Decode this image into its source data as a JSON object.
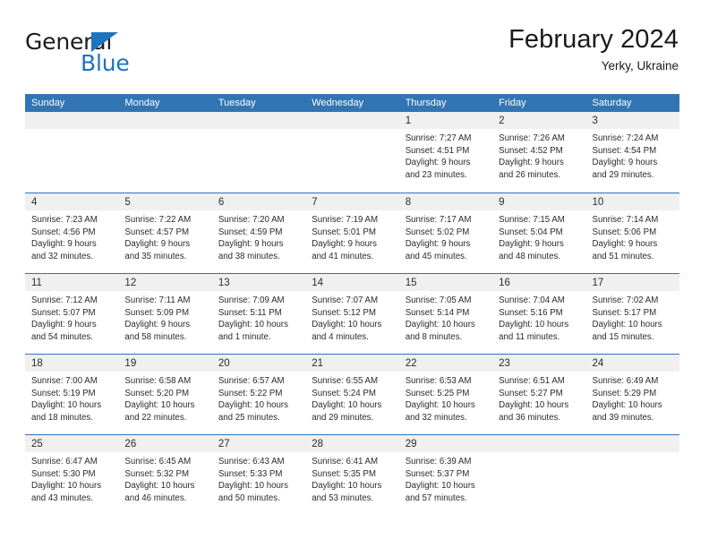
{
  "brand": {
    "name_part1": "General",
    "name_part2": "Blue",
    "accent_color": "#1e73be"
  },
  "header": {
    "title": "February 2024",
    "subtitle": "Yerky, Ukraine"
  },
  "theme": {
    "header_blue": "#3275b4",
    "rule_blue": "#2e74b5",
    "day_band_gray": "#f0f0f0"
  },
  "weekdays": [
    "Sunday",
    "Monday",
    "Tuesday",
    "Wednesday",
    "Thursday",
    "Friday",
    "Saturday"
  ],
  "weeks": [
    [
      {
        "day": "",
        "empty": true
      },
      {
        "day": "",
        "empty": true
      },
      {
        "day": "",
        "empty": true
      },
      {
        "day": "",
        "empty": true
      },
      {
        "day": "1",
        "sunrise": "Sunrise: 7:27 AM",
        "sunset": "Sunset: 4:51 PM",
        "daylight1": "Daylight: 9 hours",
        "daylight2": "and 23 minutes."
      },
      {
        "day": "2",
        "sunrise": "Sunrise: 7:26 AM",
        "sunset": "Sunset: 4:52 PM",
        "daylight1": "Daylight: 9 hours",
        "daylight2": "and 26 minutes."
      },
      {
        "day": "3",
        "sunrise": "Sunrise: 7:24 AM",
        "sunset": "Sunset: 4:54 PM",
        "daylight1": "Daylight: 9 hours",
        "daylight2": "and 29 minutes."
      }
    ],
    [
      {
        "day": "4",
        "sunrise": "Sunrise: 7:23 AM",
        "sunset": "Sunset: 4:56 PM",
        "daylight1": "Daylight: 9 hours",
        "daylight2": "and 32 minutes."
      },
      {
        "day": "5",
        "sunrise": "Sunrise: 7:22 AM",
        "sunset": "Sunset: 4:57 PM",
        "daylight1": "Daylight: 9 hours",
        "daylight2": "and 35 minutes."
      },
      {
        "day": "6",
        "sunrise": "Sunrise: 7:20 AM",
        "sunset": "Sunset: 4:59 PM",
        "daylight1": "Daylight: 9 hours",
        "daylight2": "and 38 minutes."
      },
      {
        "day": "7",
        "sunrise": "Sunrise: 7:19 AM",
        "sunset": "Sunset: 5:01 PM",
        "daylight1": "Daylight: 9 hours",
        "daylight2": "and 41 minutes."
      },
      {
        "day": "8",
        "sunrise": "Sunrise: 7:17 AM",
        "sunset": "Sunset: 5:02 PM",
        "daylight1": "Daylight: 9 hours",
        "daylight2": "and 45 minutes."
      },
      {
        "day": "9",
        "sunrise": "Sunrise: 7:15 AM",
        "sunset": "Sunset: 5:04 PM",
        "daylight1": "Daylight: 9 hours",
        "daylight2": "and 48 minutes."
      },
      {
        "day": "10",
        "sunrise": "Sunrise: 7:14 AM",
        "sunset": "Sunset: 5:06 PM",
        "daylight1": "Daylight: 9 hours",
        "daylight2": "and 51 minutes."
      }
    ],
    [
      {
        "day": "11",
        "sunrise": "Sunrise: 7:12 AM",
        "sunset": "Sunset: 5:07 PM",
        "daylight1": "Daylight: 9 hours",
        "daylight2": "and 54 minutes."
      },
      {
        "day": "12",
        "sunrise": "Sunrise: 7:11 AM",
        "sunset": "Sunset: 5:09 PM",
        "daylight1": "Daylight: 9 hours",
        "daylight2": "and 58 minutes."
      },
      {
        "day": "13",
        "sunrise": "Sunrise: 7:09 AM",
        "sunset": "Sunset: 5:11 PM",
        "daylight1": "Daylight: 10 hours",
        "daylight2": "and 1 minute."
      },
      {
        "day": "14",
        "sunrise": "Sunrise: 7:07 AM",
        "sunset": "Sunset: 5:12 PM",
        "daylight1": "Daylight: 10 hours",
        "daylight2": "and 4 minutes."
      },
      {
        "day": "15",
        "sunrise": "Sunrise: 7:05 AM",
        "sunset": "Sunset: 5:14 PM",
        "daylight1": "Daylight: 10 hours",
        "daylight2": "and 8 minutes."
      },
      {
        "day": "16",
        "sunrise": "Sunrise: 7:04 AM",
        "sunset": "Sunset: 5:16 PM",
        "daylight1": "Daylight: 10 hours",
        "daylight2": "and 11 minutes."
      },
      {
        "day": "17",
        "sunrise": "Sunrise: 7:02 AM",
        "sunset": "Sunset: 5:17 PM",
        "daylight1": "Daylight: 10 hours",
        "daylight2": "and 15 minutes."
      }
    ],
    [
      {
        "day": "18",
        "sunrise": "Sunrise: 7:00 AM",
        "sunset": "Sunset: 5:19 PM",
        "daylight1": "Daylight: 10 hours",
        "daylight2": "and 18 minutes."
      },
      {
        "day": "19",
        "sunrise": "Sunrise: 6:58 AM",
        "sunset": "Sunset: 5:20 PM",
        "daylight1": "Daylight: 10 hours",
        "daylight2": "and 22 minutes."
      },
      {
        "day": "20",
        "sunrise": "Sunrise: 6:57 AM",
        "sunset": "Sunset: 5:22 PM",
        "daylight1": "Daylight: 10 hours",
        "daylight2": "and 25 minutes."
      },
      {
        "day": "21",
        "sunrise": "Sunrise: 6:55 AM",
        "sunset": "Sunset: 5:24 PM",
        "daylight1": "Daylight: 10 hours",
        "daylight2": "and 29 minutes."
      },
      {
        "day": "22",
        "sunrise": "Sunrise: 6:53 AM",
        "sunset": "Sunset: 5:25 PM",
        "daylight1": "Daylight: 10 hours",
        "daylight2": "and 32 minutes."
      },
      {
        "day": "23",
        "sunrise": "Sunrise: 6:51 AM",
        "sunset": "Sunset: 5:27 PM",
        "daylight1": "Daylight: 10 hours",
        "daylight2": "and 36 minutes."
      },
      {
        "day": "24",
        "sunrise": "Sunrise: 6:49 AM",
        "sunset": "Sunset: 5:29 PM",
        "daylight1": "Daylight: 10 hours",
        "daylight2": "and 39 minutes."
      }
    ],
    [
      {
        "day": "25",
        "sunrise": "Sunrise: 6:47 AM",
        "sunset": "Sunset: 5:30 PM",
        "daylight1": "Daylight: 10 hours",
        "daylight2": "and 43 minutes."
      },
      {
        "day": "26",
        "sunrise": "Sunrise: 6:45 AM",
        "sunset": "Sunset: 5:32 PM",
        "daylight1": "Daylight: 10 hours",
        "daylight2": "and 46 minutes."
      },
      {
        "day": "27",
        "sunrise": "Sunrise: 6:43 AM",
        "sunset": "Sunset: 5:33 PM",
        "daylight1": "Daylight: 10 hours",
        "daylight2": "and 50 minutes."
      },
      {
        "day": "28",
        "sunrise": "Sunrise: 6:41 AM",
        "sunset": "Sunset: 5:35 PM",
        "daylight1": "Daylight: 10 hours",
        "daylight2": "and 53 minutes."
      },
      {
        "day": "29",
        "sunrise": "Sunrise: 6:39 AM",
        "sunset": "Sunset: 5:37 PM",
        "daylight1": "Daylight: 10 hours",
        "daylight2": "and 57 minutes."
      },
      {
        "day": "",
        "empty": true
      },
      {
        "day": "",
        "empty": true
      }
    ]
  ]
}
